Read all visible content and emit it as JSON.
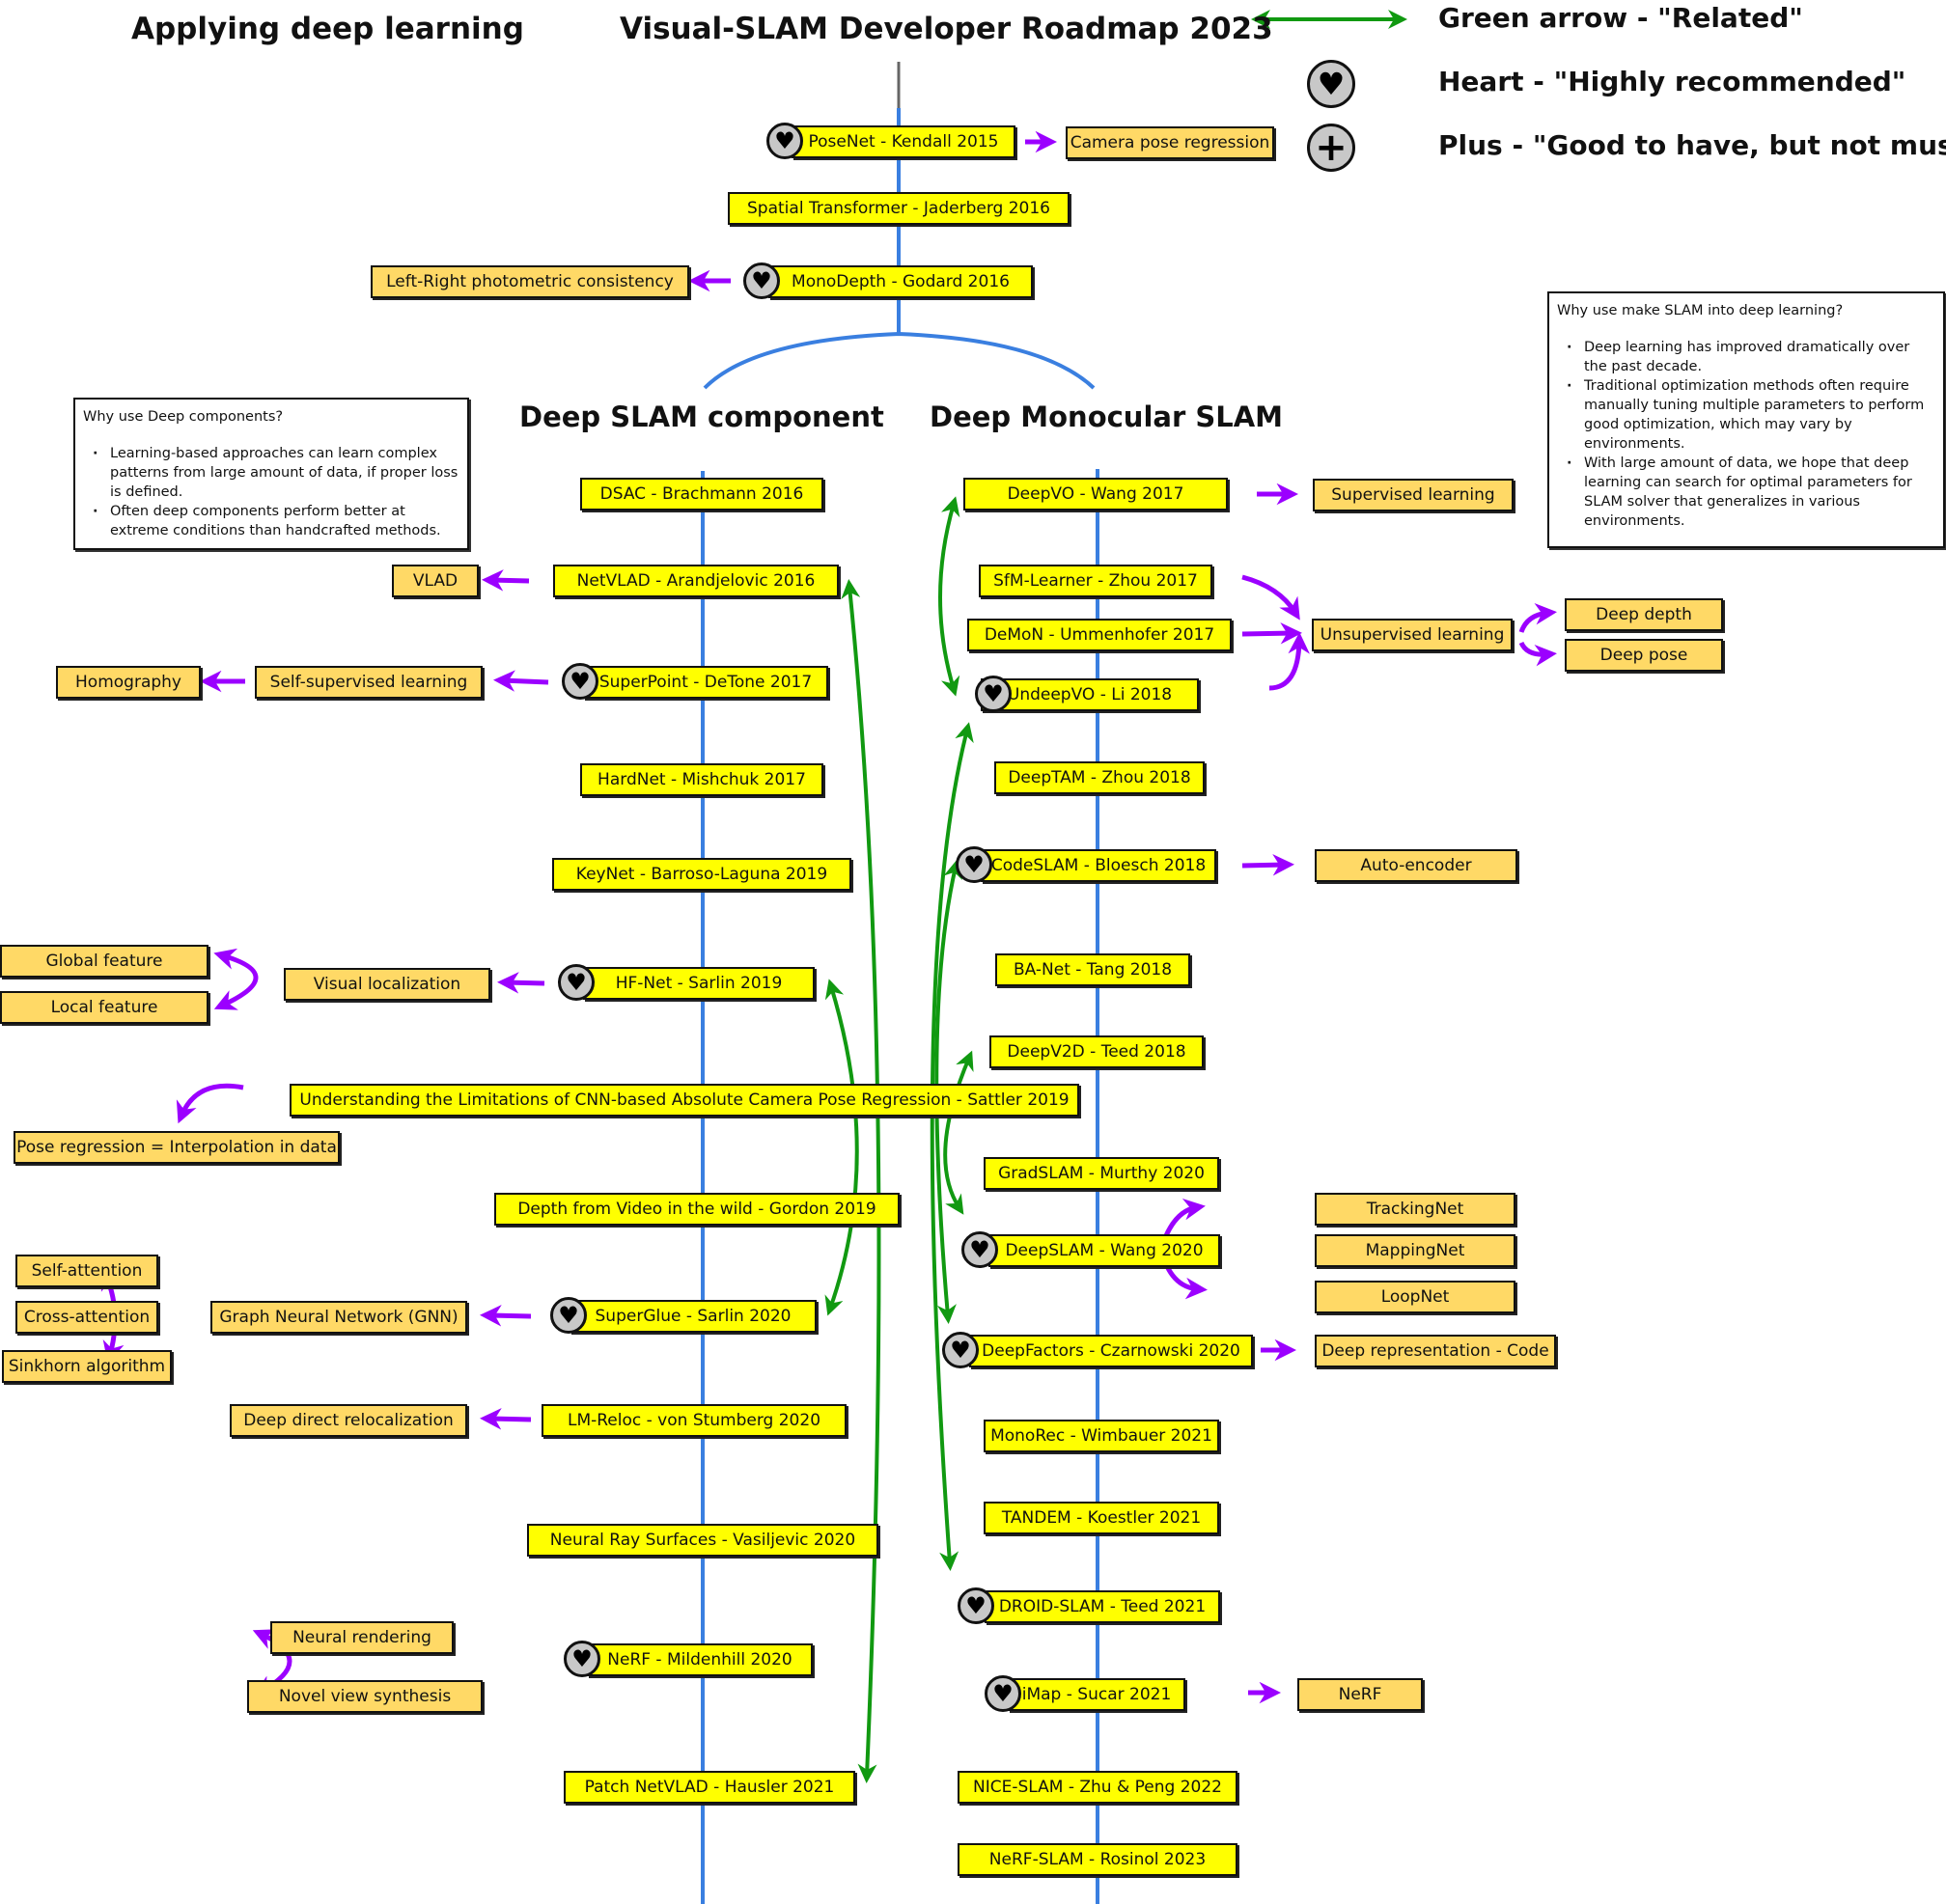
{
  "titles": {
    "left": "Applying deep learning",
    "main": "Visual-SLAM Developer Roadmap 2023"
  },
  "legend": {
    "green_arrow": "Green arrow - \"Related\"",
    "heart": "Heart - \"Highly recommended\"",
    "plus": "Plus - \"Good to have, but not must\""
  },
  "colors": {
    "main_node": "#ffff00",
    "sub_node": "#ffd966",
    "spine": "#3a7fe0",
    "related_arrow": "#119911",
    "sub_arrow": "#9b00ff"
  },
  "sections": {
    "left": "Deep SLAM component",
    "right": "Deep Monocular SLAM"
  },
  "notes": {
    "components": {
      "question": "Why use Deep components?",
      "bullets": [
        "Learning-based approaches can learn complex patterns from large amount of data, if proper loss is defined.",
        "Often deep components perform better at extreme conditions than handcrafted methods."
      ]
    },
    "slam": {
      "question": "Why use make SLAM into deep learning?",
      "bullets": [
        "Deep learning has improved dramatically over the past decade.",
        "Traditional optimization methods often require manually tuning multiple parameters to perform good optimization, which may vary by environments.",
        "With large amount of data, we hope that deep learning can search for optimal parameters for SLAM solver that generalizes in various environments."
      ]
    }
  },
  "top_nodes": {
    "posenet": "PoseNet - Kendall 2015",
    "camera_pose_regression": "Camera pose regression",
    "spatial_transformer": "Spatial Transformer - Jaderberg 2016",
    "monodepth": "MonoDepth - Godard 2016",
    "left_right": "Left-Right photometric consistency"
  },
  "component_nodes": {
    "dsac": "DSAC - Brachmann 2016",
    "netvlad": "NetVLAD - Arandjelovic 2016",
    "vlad": "VLAD",
    "superpoint": "SuperPoint - DeTone 2017",
    "self_supervised": "Self-supervised learning",
    "homography": "Homography",
    "hardnet": "HardNet - Mishchuk 2017",
    "keynet": "KeyNet - Barroso-Laguna 2019",
    "hfnet": "HF-Net - Sarlin 2019",
    "visual_localization": "Visual localization",
    "global_feature": "Global feature",
    "local_feature": "Local feature",
    "sattler": "Understanding the Limitations of CNN-based Absolute Camera Pose Regression - Sattler 2019",
    "pose_interp": "Pose regression = Interpolation in data",
    "gordon": "Depth from Video in the wild - Gordon 2019",
    "superglue": "SuperGlue - Sarlin 2020",
    "gnn": "Graph Neural Network (GNN)",
    "self_attention": "Self-attention",
    "cross_attention": "Cross-attention",
    "sinkhorn": "Sinkhorn algorithm",
    "lmreloc": "LM-Reloc - von Stumberg 2020",
    "deep_direct_reloc": "Deep direct relocalization",
    "neural_ray": "Neural Ray Surfaces - Vasiljevic 2020",
    "nerf": "NeRF - Mildenhill 2020",
    "neural_rendering": "Neural rendering",
    "novel_view": "Novel view synthesis",
    "patch_netvlad": "Patch NetVLAD - Hausler 2021"
  },
  "mono_nodes": {
    "deepvo": "DeepVO - Wang 2017",
    "supervised": "Supervised learning",
    "sfm_learner": "SfM-Learner - Zhou 2017",
    "demon": "DeMoN - Ummenhofer 2017",
    "unsupervised": "Unsupervised learning",
    "deep_depth": "Deep depth",
    "deep_pose": "Deep pose",
    "undeepvo": "UndeepVO - Li 2018",
    "deeptam": "DeepTAM - Zhou 2018",
    "codeslam": "CodeSLAM - Bloesch 2018",
    "auto_encoder": "Auto-encoder",
    "banet": "BA-Net - Tang 2018",
    "deepv2d": "DeepV2D - Teed 2018",
    "gradslam": "GradSLAM - Murthy 2020",
    "deepslam": "DeepSLAM - Wang 2020",
    "trackingnet": "TrackingNet",
    "mappingnet": "MappingNet",
    "loopnet": "LoopNet",
    "deepfactors": "DeepFactors - Czarnowski 2020",
    "deep_repr": "Deep representation - Code",
    "monorec": "MonoRec - Wimbauer 2021",
    "tandem": "TANDEM - Koestler 2021",
    "droid": "DROID-SLAM - Teed 2021",
    "imap": "iMap - Sucar 2021",
    "imap_nerf": "NeRF",
    "niceslam": "NICE-SLAM - Zhu & Peng 2022",
    "nerfslam": "NeRF-SLAM - Rosinol 2023"
  },
  "icons": {
    "heart": "♥",
    "plus": "+"
  }
}
